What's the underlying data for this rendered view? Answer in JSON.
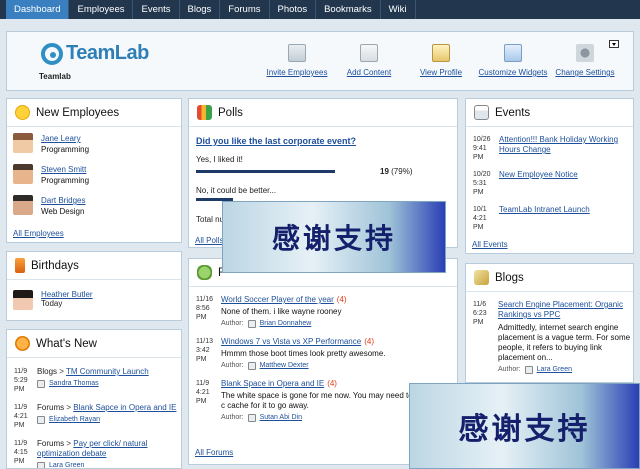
{
  "nav": {
    "tabs": [
      {
        "label": "Dashboard",
        "active": true
      },
      {
        "label": "Employees",
        "active": false
      },
      {
        "label": "Events",
        "active": false
      },
      {
        "label": "Blogs",
        "active": false
      },
      {
        "label": "Forums",
        "active": false
      },
      {
        "label": "Photos",
        "active": false
      },
      {
        "label": "Bookmarks",
        "active": false
      },
      {
        "label": "Wiki",
        "active": false
      }
    ]
  },
  "header": {
    "logo_text": "TeamLab",
    "site_name": "Teamlab",
    "actions": [
      {
        "label": "Invite Employees",
        "icon": "invite-employees-icon"
      },
      {
        "label": "Add Content",
        "icon": "add-content-icon"
      },
      {
        "label": "View Profile",
        "icon": "view-profile-icon"
      },
      {
        "label": "Customize Widgets",
        "icon": "customize-widgets-icon"
      },
      {
        "label": "Change Settings",
        "icon": "gear-icon"
      }
    ]
  },
  "new_employees": {
    "title": "New Employees",
    "items": [
      {
        "name": "Jane Leary",
        "department": "Programming"
      },
      {
        "name": "Steven Smitt",
        "department": "Programming"
      },
      {
        "name": "Dart Bridges",
        "department": "Web Design"
      }
    ],
    "footer": "All Employees"
  },
  "polls": {
    "title": "Polls",
    "question": "Did you like the last corporate event?",
    "options": [
      {
        "label": "Yes, I liked it!",
        "votes": "19",
        "percent": "(79%)",
        "fraction": 0.79
      },
      {
        "label": "No, it could be better...",
        "votes": "",
        "percent": "",
        "fraction": 0.21
      }
    ],
    "total_label": "Total nu",
    "footer": "All Polls"
  },
  "events": {
    "title": "Events",
    "items": [
      {
        "date": "10/26",
        "time": "9:41",
        "ampm": "PM",
        "title": "Attention!!! Bank Holiday Working Hours Change"
      },
      {
        "date": "10/20",
        "time": "5:31",
        "ampm": "PM",
        "title": "New Employee Notice"
      },
      {
        "date": "10/1",
        "time": "4:21",
        "ampm": "PM",
        "title": "TeamLab Intranet Launch"
      }
    ],
    "footer": "All Events"
  },
  "birthdays": {
    "title": "Birthdays",
    "items": [
      {
        "name": "Heather Butler",
        "when": "Today"
      }
    ]
  },
  "whats_new": {
    "title": "What's New",
    "items": [
      {
        "date": "11/9",
        "time": "5:29",
        "ampm": "PM",
        "section": "Blogs",
        "sep": ">",
        "title": "TM Community Launch",
        "author": "Sandra Thomas"
      },
      {
        "date": "11/9",
        "time": "4:21",
        "ampm": "PM",
        "section": "Forums",
        "sep": ">",
        "title": "Blank Sapce in Opera and IE",
        "author": "Elizabeth Rayan"
      },
      {
        "date": "11/9",
        "time": "4:15",
        "ampm": "PM",
        "section": "Forums",
        "sep": ">",
        "title": "Pay per click/ natural optimization debate",
        "author": "Lara Green"
      }
    ]
  },
  "forums": {
    "title_partial": "F",
    "author_label": "Author:",
    "items": [
      {
        "date": "11/16",
        "time": "8:56",
        "ampm": "PM",
        "title": "World Soccer Player of the year",
        "count": "(4)",
        "text": "None of them. i like wayne rooney",
        "author": "Brian Donnahew"
      },
      {
        "date": "11/13",
        "time": "3:42",
        "ampm": "PM",
        "title": "Windows 7 vs Vista vs XP Performance",
        "count": "(4)",
        "text": "Hmmm those boot times look pretty awesome.",
        "author": "Matthew Dexter"
      },
      {
        "date": "11/9",
        "time": "4:21",
        "ampm": "PM",
        "title": "Blank Space in Opera and IE",
        "count": "(4)",
        "text": "The white space is gone for me now. You may need to c cache for it to go away.",
        "author": "Sutan Abi Din"
      }
    ],
    "footer": "All Forums"
  },
  "blogs": {
    "title": "Blogs",
    "author_label": "Author:",
    "items": [
      {
        "date": "11/6",
        "time": "6:23",
        "ampm": "PM",
        "title": "Search Engine Placement: Organic Rankings vs PPC",
        "text": "Admittedly, internet search engine placement is a vague term. For some people, it refers to buying link placement on...",
        "author": "Lara Green"
      }
    ]
  },
  "watermark": {
    "text": "感谢支持"
  },
  "colors": {
    "nav_bg": "#22374e",
    "nav_active": "#3a7fbf",
    "link": "#1e4f9a",
    "accent_red": "#e03a1a"
  }
}
